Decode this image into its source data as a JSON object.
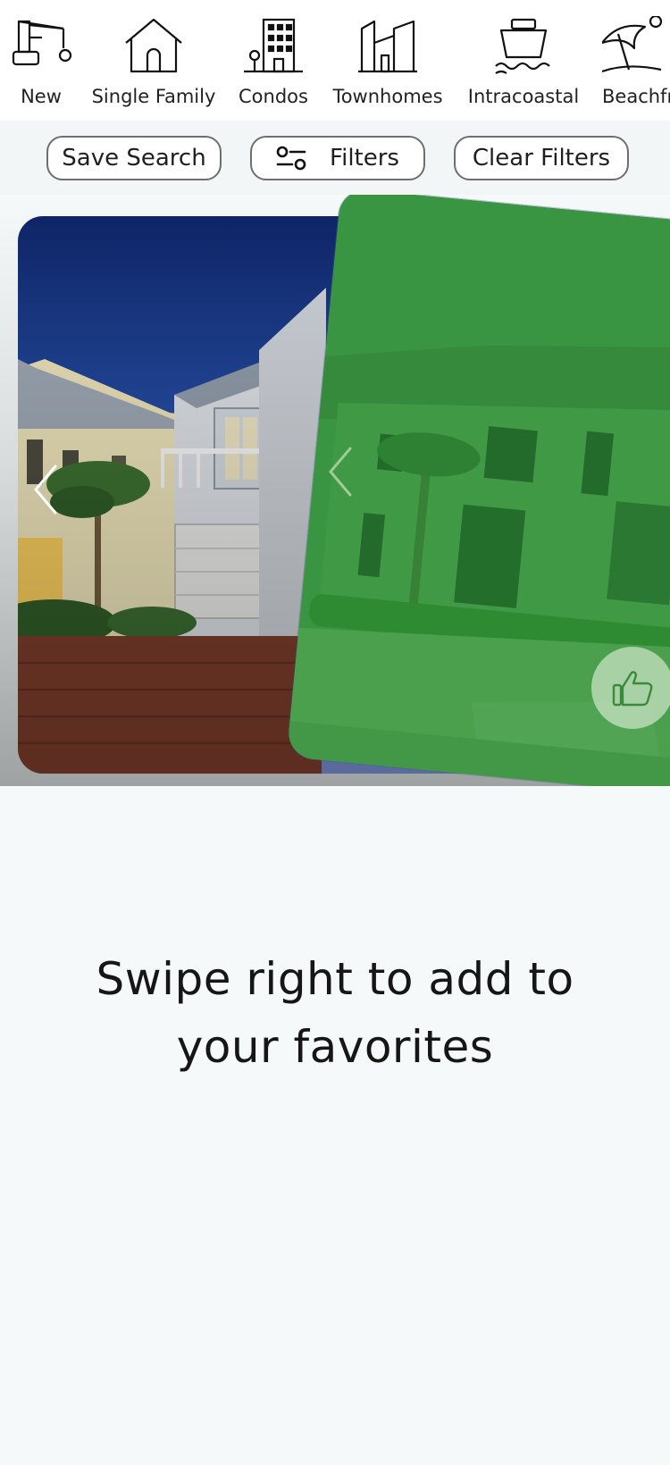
{
  "categories": [
    {
      "label": "New",
      "icon": "crane-icon"
    },
    {
      "label": "Single Family",
      "icon": "house-icon"
    },
    {
      "label": "Condos",
      "icon": "condo-building-icon"
    },
    {
      "label": "Townhomes",
      "icon": "townhome-icon"
    },
    {
      "label": "Intracoastal",
      "icon": "boat-icon"
    },
    {
      "label": "Beachfr",
      "icon": "beach-umbrella-icon"
    }
  ],
  "actions": {
    "save_search": "Save Search",
    "filters": "Filters",
    "clear_filters": "Clear Filters"
  },
  "swipe": {
    "like_icon": "thumbs-up-icon",
    "prev_icon": "chevron-left-icon",
    "like_overlay_color": "#2e8b3a"
  },
  "hint": {
    "text": "Swipe right to add to your favorites"
  },
  "colors": {
    "sky_dark": "#0e2a6e",
    "sky_light": "#3c6fc4",
    "accent_green": "#2a8a3a",
    "pill_border": "#6e6e6e"
  }
}
